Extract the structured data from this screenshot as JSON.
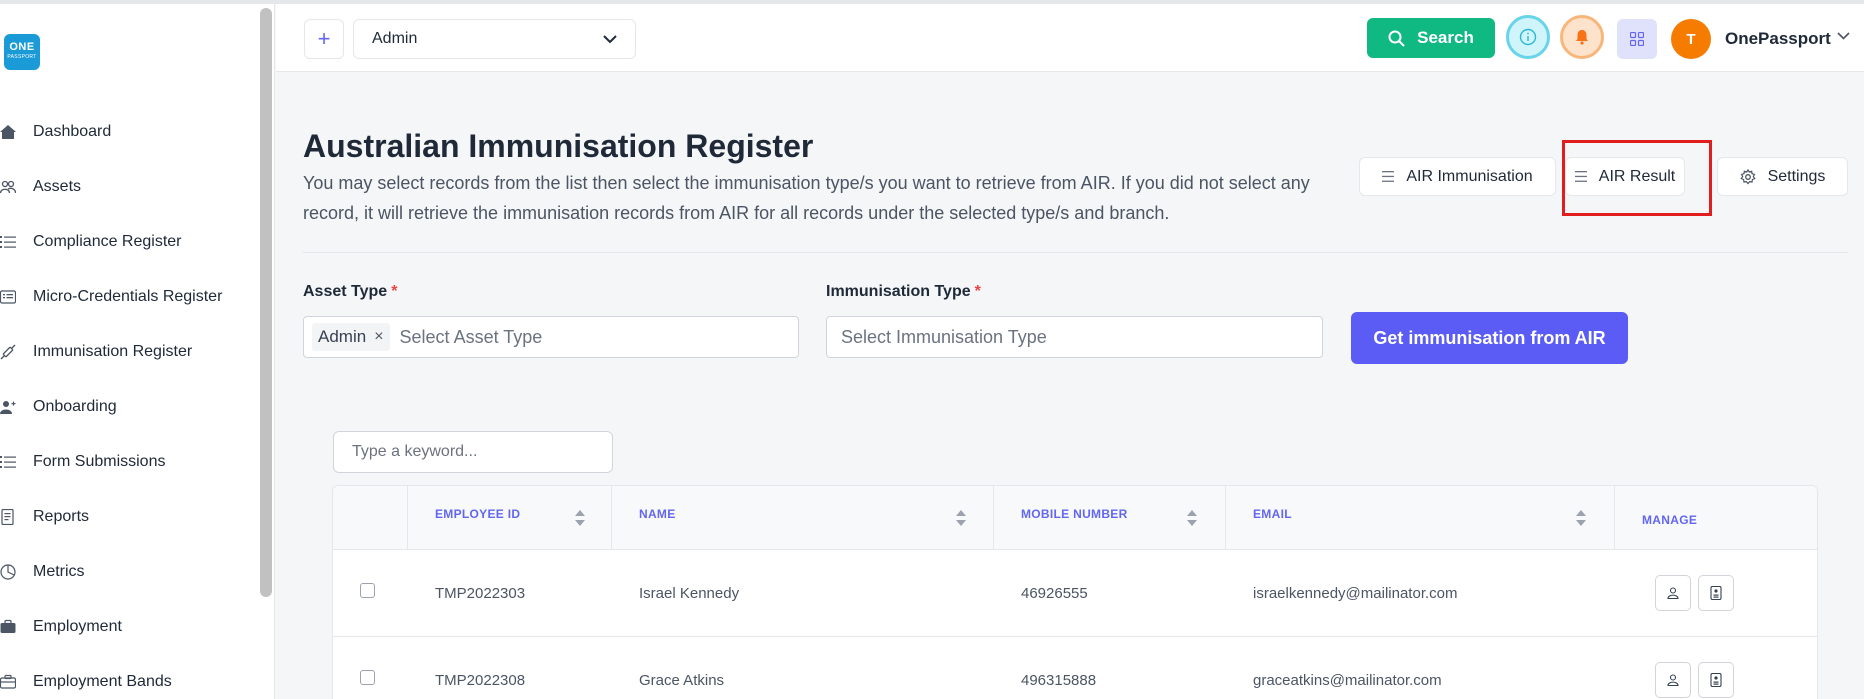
{
  "brand": {
    "logo_top": "ONE",
    "logo_bottom": "PASSPORT"
  },
  "sidebar": {
    "items": [
      {
        "label": "Dashboard",
        "icon": "home-icon"
      },
      {
        "label": "Assets",
        "icon": "users-icon"
      },
      {
        "label": "Compliance Register",
        "icon": "list-icon"
      },
      {
        "label": "Micro-Credentials Register",
        "icon": "id-card-icon"
      },
      {
        "label": "Immunisation Register",
        "icon": "syringe-icon"
      },
      {
        "label": "Onboarding",
        "icon": "user-plus-icon"
      },
      {
        "label": "Form Submissions",
        "icon": "list-icon"
      },
      {
        "label": "Reports",
        "icon": "document-icon"
      },
      {
        "label": "Metrics",
        "icon": "pie-chart-icon"
      },
      {
        "label": "Employment",
        "icon": "briefcase-icon"
      },
      {
        "label": "Employment Bands",
        "icon": "briefcase-icon"
      }
    ]
  },
  "header": {
    "branch_value": "Admin",
    "search_label": "Search",
    "user_initial": "T",
    "user_name": "OnePassport",
    "accent_search": "#10b981"
  },
  "page": {
    "title": "Australian Immunisation Register",
    "description": "You may select records from the list then select the immunisation type/s you want to retrieve from AIR. If you did not select any record, it will retrieve the immunisation records from AIR for all records under the selected type/s and branch.",
    "actions": {
      "air_immunisation": "AIR Immunisation",
      "air_result": "AIR Result",
      "settings": "Settings"
    }
  },
  "form": {
    "asset_type_label": "Asset Type",
    "required_mark": "*",
    "asset_type_tag": "Admin",
    "asset_type_tag_remove": "×",
    "asset_type_placeholder": "Select Asset Type",
    "immunisation_type_label": "Immunisation Type",
    "immunisation_type_placeholder": "Select Immunisation Type",
    "submit_label": "Get immunisation from AIR",
    "accent_submit": "#5b5bf5"
  },
  "table": {
    "search_placeholder": "Type a keyword...",
    "columns": {
      "employee_id": "EMPLOYEE ID",
      "name": "NAME",
      "mobile": "MOBILE NUMBER",
      "email": "EMAIL",
      "manage": "MANAGE"
    },
    "rows": [
      {
        "employee_id": "TMP2022303",
        "name": "Israel Kennedy",
        "mobile": "46926555",
        "email": "israelkennedy@mailinator.com"
      },
      {
        "employee_id": "TMP2022308",
        "name": "Grace Atkins",
        "mobile": "496315888",
        "email": "graceatkins@mailinator.com"
      }
    ]
  }
}
